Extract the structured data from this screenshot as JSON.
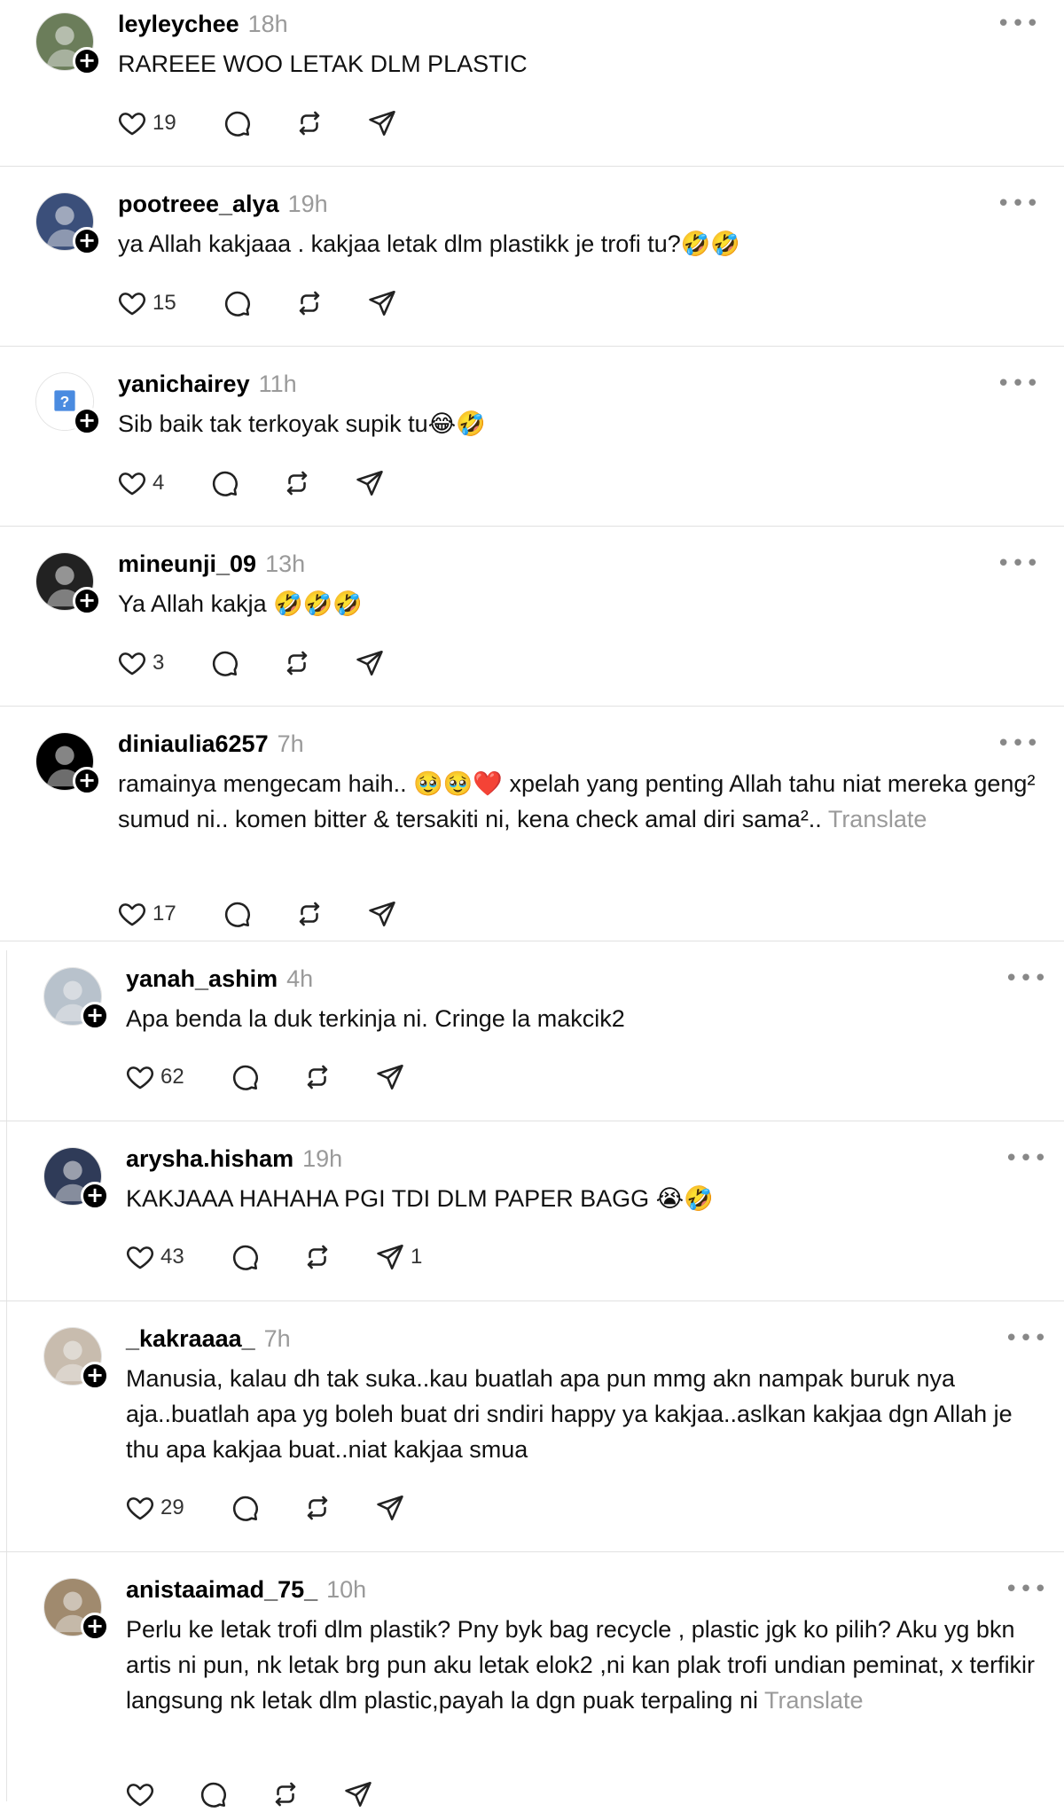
{
  "posts": [
    {
      "username": "leyleychee",
      "time": "18h",
      "text": "RAREEE WOO LETAK DLM PLASTIC",
      "translate": "",
      "likes": "19",
      "replies": "",
      "reposts": "",
      "shares": "",
      "avatar_color": "#6b7d5a"
    },
    {
      "username": "pootreee_alya",
      "time": "19h",
      "text": "ya Allah kakjaaa . kakjaa letak dlm plastikk je trofi tu?🤣🤣",
      "translate": "",
      "likes": "15",
      "replies": "",
      "reposts": "",
      "shares": "",
      "avatar_color": "#3b4f7a"
    },
    {
      "username": "yanichairey",
      "time": "11h",
      "text": "Sib baik tak terkoyak supik tu😂🤣",
      "translate": "",
      "likes": "4",
      "replies": "",
      "reposts": "",
      "shares": "",
      "avatar_color": "#ffffff"
    },
    {
      "username": "mineunji_09",
      "time": "13h",
      "text": "Ya Allah kakja 🤣🤣🤣",
      "translate": "",
      "likes": "3",
      "replies": "",
      "reposts": "",
      "shares": "",
      "avatar_color": "#222222"
    },
    {
      "username": "diniaulia6257",
      "time": "7h",
      "text": "ramainya mengecam haih.. 🥹🥹❤️ xpelah yang penting Allah tahu niat mereka geng² sumud ni.. komen bitter & tersakiti ni, kena check amal diri sama²..",
      "translate": "Translate",
      "likes": "17",
      "replies": "",
      "reposts": "",
      "shares": "",
      "avatar_color": "#000000"
    },
    {
      "username": "yanah_ashim",
      "time": "4h",
      "text": "Apa benda la duk terkinja ni. Cringe la makcik2",
      "translate": "",
      "likes": "62",
      "replies": "",
      "reposts": "",
      "shares": "",
      "avatar_color": "#b8c2cc"
    },
    {
      "username": "arysha.hisham",
      "time": "19h",
      "text": "KAKJAAA HAHAHA PGI TDI DLM PAPER BAGG 😭🤣",
      "translate": "",
      "likes": "43",
      "replies": "",
      "reposts": "",
      "shares": "1",
      "avatar_color": "#2f3b58"
    },
    {
      "username": "_kakraaaa_",
      "time": "7h",
      "text": "Manusia, kalau dh tak suka..kau buatlah apa pun mmg akn nampak buruk nya aja..buatlah apa yg boleh buat dri sndiri happy ya kakjaa..aslkan kakjaa dgn Allah je thu apa kakjaa buat..niat kakjaa smua",
      "translate": "",
      "likes": "29",
      "replies": "",
      "reposts": "",
      "shares": "",
      "avatar_color": "#c8bcae"
    },
    {
      "username": "anistaaimad_75_",
      "time": "10h",
      "text": "Perlu ke letak trofi dlm plastik? Pny byk bag recycle , plastic jgk ko pilih? Aku yg bkn artis ni pun, nk letak brg pun aku letak elok2 ,ni kan plak trofi undian peminat, x terfikir langsung nk letak dlm plastic,payah la dgn puak terpaling ni",
      "translate": "Translate",
      "likes": "",
      "replies": "",
      "reposts": "",
      "shares": "",
      "avatar_color": "#a08a6e"
    }
  ],
  "icons": {
    "like": "heart-icon",
    "reply": "comment-icon",
    "repost": "repost-icon",
    "share": "send-icon",
    "more": "more-dots-icon",
    "follow": "plus-icon"
  },
  "more_glyph": "•••",
  "plus_glyph": "+"
}
